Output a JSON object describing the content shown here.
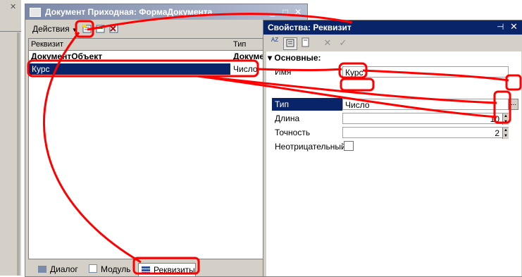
{
  "left_strip": {
    "close_glyph": "✕"
  },
  "doc_window": {
    "title": "Документ Приходная: ФормаДокумента",
    "minimize_glyph": "_",
    "maximize_glyph": "□",
    "close_glyph": "✕",
    "toolbar": {
      "actions_label": "Действия",
      "actions_arrow": "▼"
    },
    "grid": {
      "headers": [
        "Реквизит",
        "Тип"
      ],
      "rows": [
        {
          "name": "ДокументОбъект",
          "type": "Докуме"
        },
        {
          "name": "Курс",
          "type": "Число"
        }
      ]
    },
    "tabs": [
      {
        "label": "Диалог",
        "icon": "dialog-icon"
      },
      {
        "label": "Модуль",
        "icon": "module-icon"
      },
      {
        "label": "Реквизиты",
        "icon": "attributes-icon"
      }
    ]
  },
  "props_panel": {
    "title": "Свойства: Реквизит",
    "pin_glyph": "⊣",
    "close_glyph": "✕",
    "toolbar": {
      "sort_label": "AZ",
      "cancel_glyph": "✕",
      "apply_glyph": "✓"
    },
    "section": "Основные:",
    "section_glyph": "▾",
    "fields": [
      {
        "label": "Имя",
        "value": "Курс"
      },
      {
        "label": "Тип",
        "value": "Число"
      },
      {
        "label": "Длина",
        "value": "10"
      },
      {
        "label": "Точность",
        "value": "2"
      },
      {
        "label": "Неотрицательный",
        "value": ""
      }
    ],
    "ellipsis": "..."
  },
  "colors": {
    "selection": "#0a246a",
    "annotation": "#ff0000",
    "window_bg": "#d4d0c8"
  }
}
